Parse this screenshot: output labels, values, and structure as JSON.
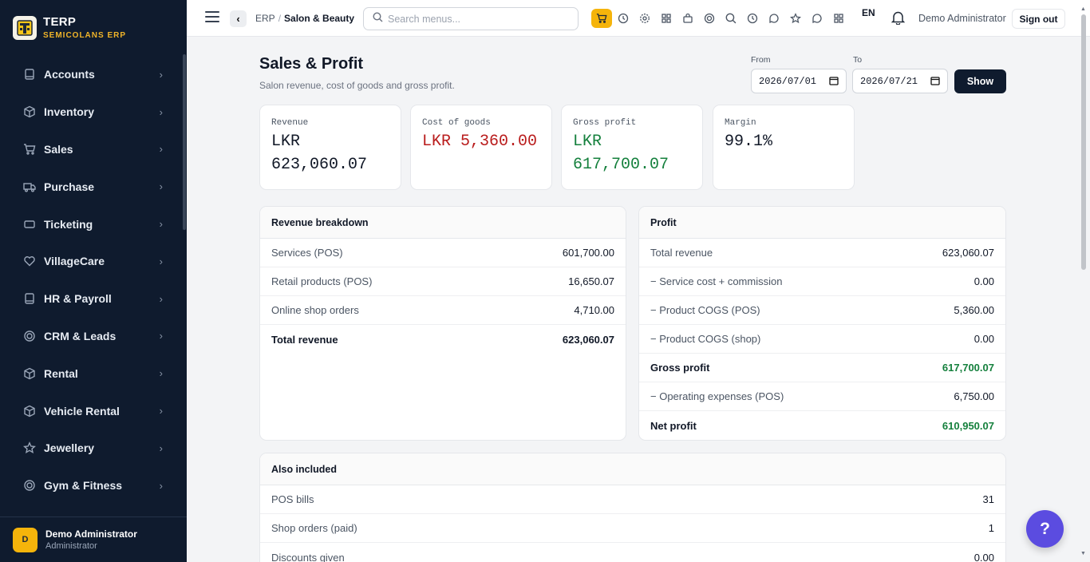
{
  "brand": {
    "title": "TERP",
    "subtitle": "SEMICOLANS ERP"
  },
  "sidebar": {
    "items": [
      {
        "label": "Accounts",
        "icon": "book-icon"
      },
      {
        "label": "Inventory",
        "icon": "box-icon"
      },
      {
        "label": "Sales",
        "icon": "cart-icon"
      },
      {
        "label": "Purchase",
        "icon": "truck-icon"
      },
      {
        "label": "Ticketing",
        "icon": "ticket-icon"
      },
      {
        "label": "VillageCare",
        "icon": "heart-icon"
      },
      {
        "label": "HR & Payroll",
        "icon": "book-icon"
      },
      {
        "label": "CRM & Leads",
        "icon": "target-icon"
      },
      {
        "label": "Rental",
        "icon": "box-icon"
      },
      {
        "label": "Vehicle Rental",
        "icon": "box-icon"
      },
      {
        "label": "Jewellery",
        "icon": "star-icon"
      },
      {
        "label": "Gym & Fitness",
        "icon": "target-icon"
      }
    ],
    "user": {
      "initial": "D",
      "name": "Demo Administrator",
      "role": "Administrator"
    }
  },
  "topbar": {
    "breadcrumb": [
      "ERP",
      "Salon & Beauty"
    ],
    "search_placeholder": "Search menus...",
    "lang": "EN",
    "user": "Demo Administrator",
    "signout_label": "Sign out"
  },
  "page": {
    "title": "Sales & Profit",
    "subtitle": "Salon revenue, cost of goods and gross profit.",
    "from_label": "From",
    "from_value": "2026/07/01",
    "to_label": "To",
    "to_value": "2026/07/21",
    "show_label": "Show"
  },
  "stats": [
    {
      "label": "Revenue",
      "line1": "LKR",
      "line2": "623,060.07",
      "color": "#111827"
    },
    {
      "label": "Cost of goods",
      "line1": "LKR 5,360.00",
      "line2": "",
      "color": "#b91c1c"
    },
    {
      "label": "Gross profit",
      "line1": "LKR",
      "line2": "617,700.07",
      "color": "#15803d"
    },
    {
      "label": "Margin",
      "line1": "99.1%",
      "line2": "",
      "color": "#111827"
    }
  ],
  "revenue_breakdown": {
    "title": "Revenue breakdown",
    "rows": [
      {
        "label": "Services (POS)",
        "value": "601,700.00"
      },
      {
        "label": "Retail products (POS)",
        "value": "16,650.07"
      },
      {
        "label": "Online shop orders",
        "value": "4,710.00"
      },
      {
        "label": "Total revenue",
        "value": "623,060.07"
      }
    ]
  },
  "profit": {
    "title": "Profit",
    "rows": [
      {
        "label": "Total revenue",
        "value": "623,060.07"
      },
      {
        "label": "− Service cost + commission",
        "value": "0.00"
      },
      {
        "label": "− Product COGS (POS)",
        "value": "5,360.00"
      },
      {
        "label": "− Product COGS (shop)",
        "value": "0.00"
      },
      {
        "label": "Gross profit",
        "value": "617,700.07"
      },
      {
        "label": "− Operating expenses (POS)",
        "value": "6,750.00"
      },
      {
        "label": "Net profit",
        "value": "610,950.07"
      }
    ]
  },
  "also_included": {
    "title": "Also included",
    "rows": [
      {
        "label": "POS bills",
        "value": "31"
      },
      {
        "label": "Shop orders (paid)",
        "value": "1"
      },
      {
        "label": "Discounts given",
        "value": "0.00"
      }
    ]
  },
  "colors": {
    "sidebar_bg": "#0f1b2e",
    "accent": "#f5b40b",
    "positive": "#15803d",
    "negative": "#b91c1c",
    "help": "#5b4ce0"
  }
}
